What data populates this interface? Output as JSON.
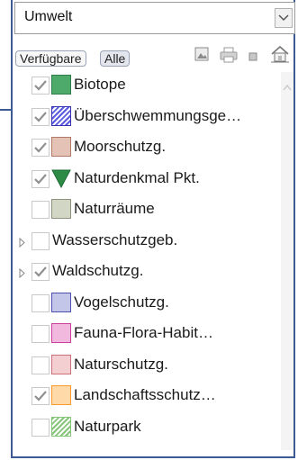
{
  "combo": {
    "value": "Umwelt"
  },
  "tabs": {
    "available": "Verfügbare",
    "all": "Alle"
  },
  "toolbar_icons": [
    "map-icon",
    "print-icon",
    "square-icon",
    "home-icon"
  ],
  "layers": [
    {
      "label": "Biotope",
      "checked": true,
      "expander": false,
      "symbol": "fill",
      "color": "#4eaa6b",
      "border": "#2f7d48"
    },
    {
      "label": "Überschwemmungsge…",
      "checked": true,
      "expander": false,
      "symbol": "hatch",
      "color": "#5a5ae0",
      "border": "#3434b0"
    },
    {
      "label": "Moorschutzg.",
      "checked": true,
      "expander": false,
      "symbol": "fill",
      "color": "#e4c2b6",
      "border": "#b07a66"
    },
    {
      "label": "Naturdenkmal Pkt.",
      "checked": true,
      "expander": false,
      "symbol": "triangle",
      "color": "#2e8b46",
      "border": "#1f6a33"
    },
    {
      "label": "Naturräume",
      "checked": false,
      "expander": false,
      "symbol": "fill",
      "color": "#d2d6c4",
      "border": "#8d927b"
    },
    {
      "label": "Wasserschutzgeb.",
      "checked": false,
      "expander": true,
      "symbol": "none",
      "color": "",
      "border": ""
    },
    {
      "label": "Waldschutzg.",
      "checked": true,
      "expander": true,
      "symbol": "none",
      "color": "",
      "border": ""
    },
    {
      "label": "Vogelschutzg.",
      "checked": false,
      "expander": false,
      "symbol": "fill",
      "color": "#c3c6e8",
      "border": "#4a4fb0"
    },
    {
      "label": "Fauna-Flora-Habit…",
      "checked": false,
      "expander": false,
      "symbol": "fill",
      "color": "#f0b9dd",
      "border": "#cc3f9b"
    },
    {
      "label": "Naturschutzg.",
      "checked": false,
      "expander": false,
      "symbol": "fill",
      "color": "#f3cfd2",
      "border": "#cf6f77"
    },
    {
      "label": "Landschaftsschutz…",
      "checked": true,
      "expander": false,
      "symbol": "fill",
      "color": "#ffd9a8",
      "border": "#ff9a2e"
    },
    {
      "label": "Naturpark",
      "checked": false,
      "expander": false,
      "symbol": "hatch",
      "color": "#86c47a",
      "border": "#86c47a"
    }
  ]
}
